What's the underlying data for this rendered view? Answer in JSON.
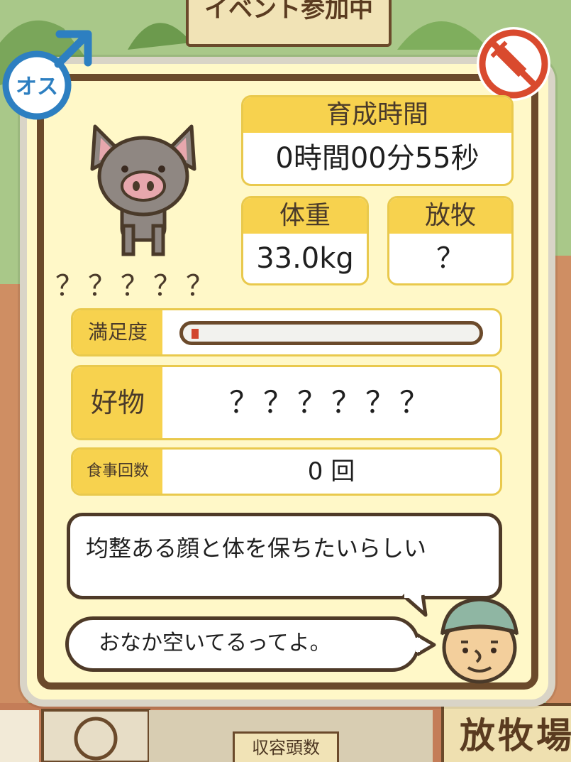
{
  "background": {
    "event_banner": "イベント参加中",
    "bottom_sign": "収容頭数",
    "right_sign": "放牧場"
  },
  "gender_badge": {
    "label": "オス",
    "icon": "male-symbol-icon",
    "color": "#2d7fc1"
  },
  "vaccine_badge": {
    "icon": "no-syringe-icon",
    "color": "#d94a2e"
  },
  "pig": {
    "name": "？？？？？",
    "icon": "gray-pig-icon"
  },
  "stats": {
    "time_label": "育成時間",
    "time_value": "0時間00分55秒",
    "weight_label": "体重",
    "weight_value": "33.0kg",
    "graze_label": "放牧",
    "graze_value": "？"
  },
  "satisfaction": {
    "label": "満足度",
    "fraction": 0.02
  },
  "favorite": {
    "label": "好物",
    "value": "？？？？？？"
  },
  "meals": {
    "label": "食事回数",
    "value": "0 回"
  },
  "messages": {
    "trait": "均整ある顔と体を保ちたいらしい",
    "status": "おなか空いてるってよ。"
  },
  "colors": {
    "panel_bg": "#fff8c8",
    "header_yellow": "#f7d24e",
    "frame_brown": "#6b4a2b",
    "satisfaction_fill": "#d2462e"
  }
}
